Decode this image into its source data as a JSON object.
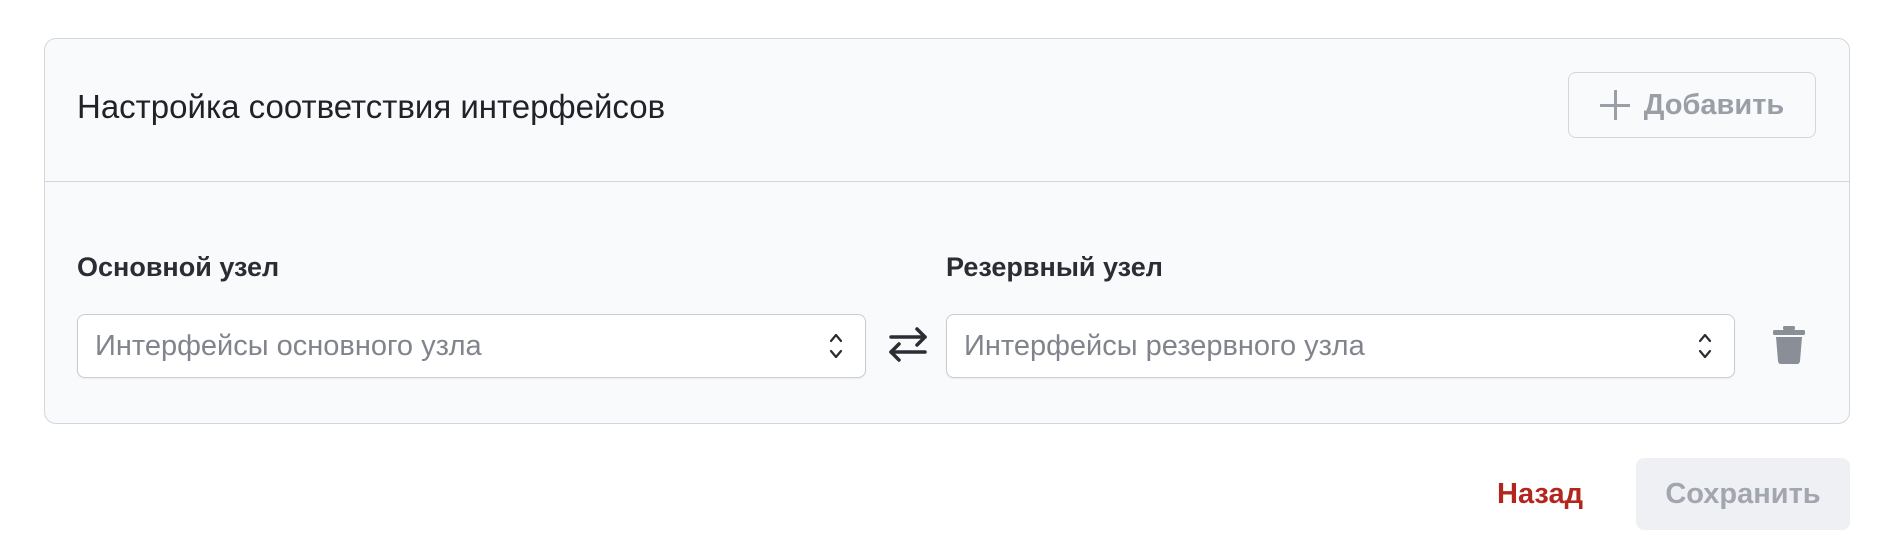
{
  "panel": {
    "title": "Настройка соответствия интерфейсов",
    "add_button_label": "Добавить"
  },
  "mapping": {
    "primary_label": "Основной узел",
    "primary_placeholder": "Интерфейсы основного узла",
    "backup_label": "Резервный узел",
    "backup_placeholder": "Интерфейсы резервного узла"
  },
  "footer": {
    "back_label": "Назад",
    "save_label": "Сохранить"
  },
  "icons": {
    "add": "plus-icon",
    "swap": "swap-arrows-icon",
    "delete": "trash-icon",
    "select": "chevron-up-down-icon"
  },
  "colors": {
    "back_link": "#b3261e",
    "disabled_text": "#a2a6ae"
  }
}
